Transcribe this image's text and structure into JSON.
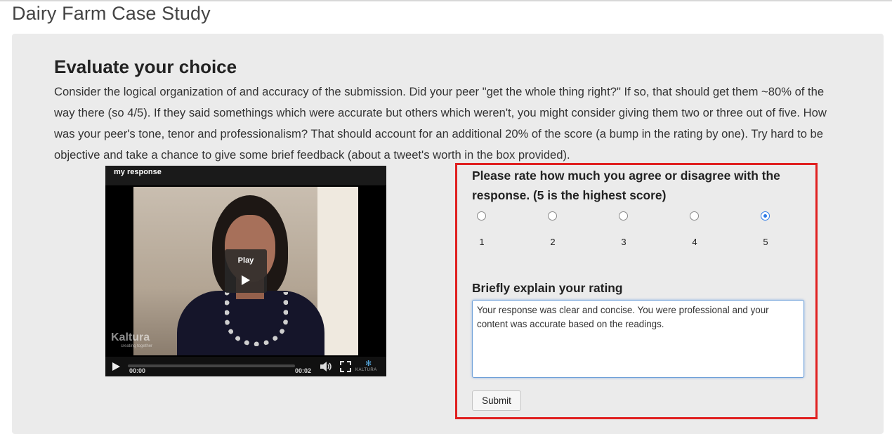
{
  "page": {
    "title": "Dairy Farm Case Study"
  },
  "evaluation": {
    "heading": "Evaluate your choice",
    "instructions": "Consider the logical organization of and accuracy of the submission.  Did your peer \"get the whole thing right?\"  If so, that should get them ~80% of the way there (so 4/5).  If they said somethings which were accurate but others which weren't, you might consider giving them two or three out of five.  How was your peer's tone, tenor and professionalism?  That should account for an additional 20% of the score (a bump in the rating by one).  Try hard to be objective and take a chance to give some brief feedback (about a tweet's worth in the box provided)."
  },
  "player": {
    "title": "my response",
    "play_label": "Play",
    "current_time": "00:00",
    "duration": "00:02",
    "logo_word": "Kaltura",
    "logo_tagline": "creating together",
    "mini_logo": "KALTURA"
  },
  "rating": {
    "question": "Please rate how much you agree or disagree with the response. (5 is the highest score)",
    "options": [
      "1",
      "2",
      "3",
      "4",
      "5"
    ],
    "selected": "5",
    "accent_color": "#2d7ae5"
  },
  "feedback": {
    "label": "Briefly explain your rating",
    "value": "Your response was clear and concise. You were professional and your content was accurate based on the readings."
  },
  "actions": {
    "submit_label": "Submit"
  },
  "highlight_color": "#e02020"
}
